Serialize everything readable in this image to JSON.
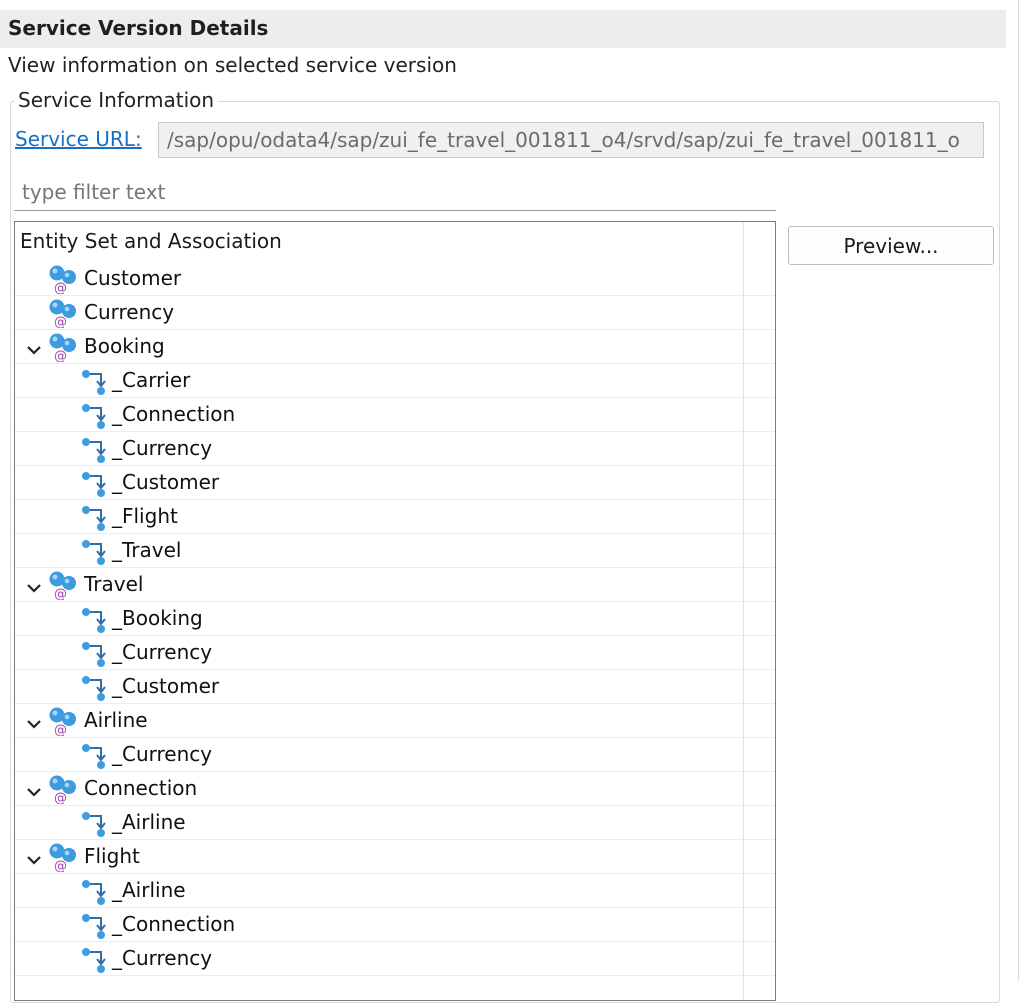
{
  "section": {
    "title": "Service Version Details",
    "subtitle": "View information on selected service version"
  },
  "service_info": {
    "group_label": "Service Information",
    "url_link": "Service URL:",
    "url_value": "/sap/opu/odata4/sap/zui_fe_travel_001811_o4/srvd/sap/zui_fe_travel_001811_o"
  },
  "filter": {
    "placeholder": "type filter text",
    "value": ""
  },
  "tree": {
    "header": "Entity Set and Association",
    "rows": [
      {
        "kind": "entity",
        "label": "Customer",
        "expanded": false
      },
      {
        "kind": "entity",
        "label": "Currency",
        "expanded": false
      },
      {
        "kind": "entity",
        "label": "Booking",
        "expanded": true
      },
      {
        "kind": "association",
        "label": "_Carrier"
      },
      {
        "kind": "association",
        "label": "_Connection"
      },
      {
        "kind": "association",
        "label": "_Currency"
      },
      {
        "kind": "association",
        "label": "_Customer"
      },
      {
        "kind": "association",
        "label": "_Flight"
      },
      {
        "kind": "association",
        "label": "_Travel"
      },
      {
        "kind": "entity",
        "label": "Travel",
        "expanded": true
      },
      {
        "kind": "association",
        "label": "_Booking"
      },
      {
        "kind": "association",
        "label": "_Currency"
      },
      {
        "kind": "association",
        "label": "_Customer"
      },
      {
        "kind": "entity",
        "label": "Airline",
        "expanded": true
      },
      {
        "kind": "association",
        "label": "_Currency"
      },
      {
        "kind": "entity",
        "label": "Connection",
        "expanded": true
      },
      {
        "kind": "association",
        "label": "_Airline"
      },
      {
        "kind": "entity",
        "label": "Flight",
        "expanded": true
      },
      {
        "kind": "association",
        "label": "_Airline"
      },
      {
        "kind": "association",
        "label": "_Connection"
      },
      {
        "kind": "association",
        "label": "_Currency"
      }
    ]
  },
  "buttons": {
    "preview": "Preview..."
  },
  "icons": {
    "entity": "entity-set-icon",
    "association": "association-icon",
    "expand": "chevron-down-icon"
  },
  "colors": {
    "link": "#1a6fc4",
    "entity_icon": "#3d9be0",
    "entity_at": "#a040b0",
    "header_bg": "#ededed"
  }
}
